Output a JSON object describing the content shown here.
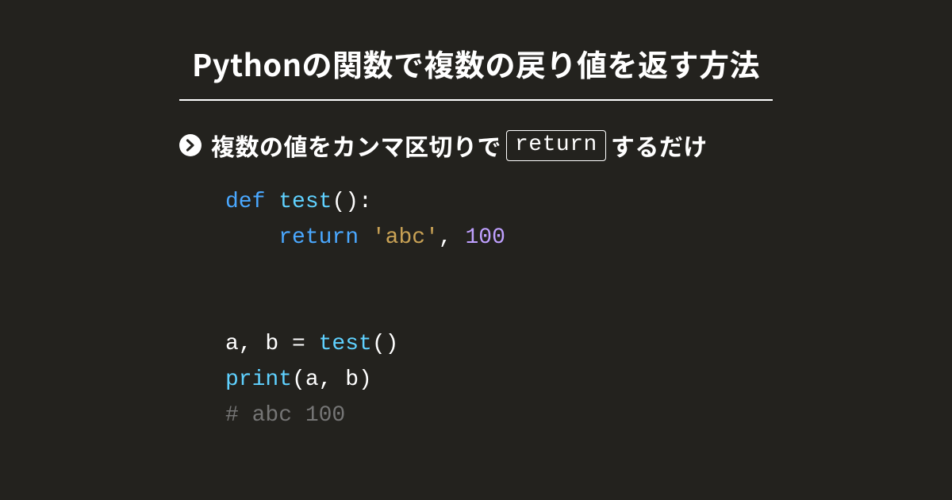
{
  "title": "Pythonの関数で複数の戻り値を返す方法",
  "subtitle": {
    "before_keyword": "複数の値をカンマ区切りで",
    "keyword": "return",
    "after_keyword": "するだけ"
  },
  "code": {
    "kw_def": "def",
    "fn_name": "test",
    "paren_open_colon": "():",
    "kw_return": "return",
    "sp": " ",
    "str_literal": "'abc'",
    "comma_sp": ", ",
    "num_literal": "100",
    "indent": "    ",
    "blank": "",
    "assign_line_pre": "a, b = ",
    "call_fn": "test",
    "parens": "()",
    "builtin_print": "print",
    "print_args": "(a, b)",
    "comment": "# abc 100"
  }
}
